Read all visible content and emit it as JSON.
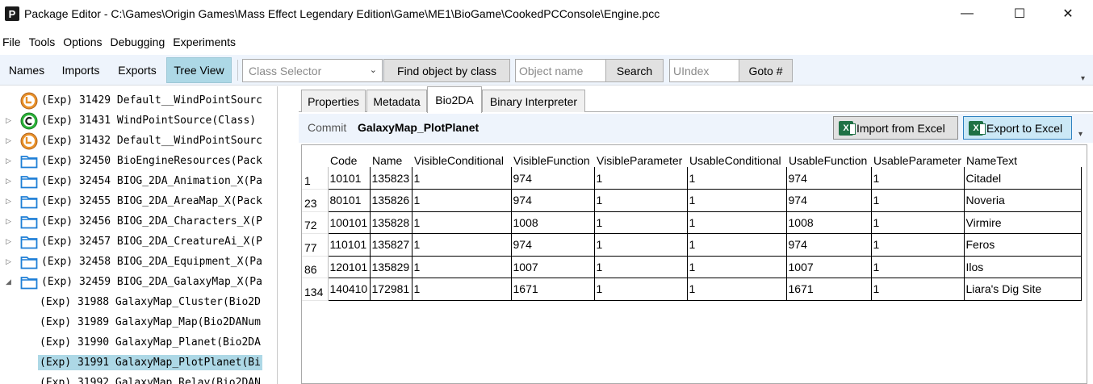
{
  "window": {
    "title": "Package Editor - C:\\Games\\Origin Games\\Mass Effect Legendary Edition\\Game\\ME1\\BioGame\\CookedPCConsole\\Engine.pcc",
    "logo_letter": "P",
    "minimize": "—",
    "maximize": "☐",
    "close": "✕"
  },
  "menu": [
    "File",
    "Tools",
    "Options",
    "Debugging",
    "Experiments"
  ],
  "toolbar": {
    "tabs": [
      "Names",
      "Imports",
      "Exports",
      "Tree View"
    ],
    "active_tab": "Tree View",
    "class_selector_placeholder": "Class Selector",
    "find_by_class_label": "Find object by class",
    "object_name_placeholder": "Object name",
    "search_label": "Search",
    "uindex_placeholder": "UIndex",
    "goto_label": "Goto #"
  },
  "tree": {
    "items": [
      {
        "expander": "",
        "icon": "orange-function-icon",
        "text": "(Exp) 31429 Default__WindPointSourc"
      },
      {
        "expander": "▷",
        "icon": "green-class-icon",
        "text": "(Exp) 31431 WindPointSource(Class)"
      },
      {
        "expander": "▷",
        "icon": "orange-function-icon",
        "text": "(Exp) 31432 Default__WindPointSourc"
      },
      {
        "expander": "▷",
        "icon": "folder-icon",
        "text": "(Exp) 32450 BioEngineResources(Pack"
      },
      {
        "expander": "▷",
        "icon": "folder-icon",
        "text": "(Exp) 32454 BIOG_2DA_Animation_X(Pa"
      },
      {
        "expander": "▷",
        "icon": "folder-icon",
        "text": "(Exp) 32455 BIOG_2DA_AreaMap_X(Pack"
      },
      {
        "expander": "▷",
        "icon": "folder-icon",
        "text": "(Exp) 32456 BIOG_2DA_Characters_X(P"
      },
      {
        "expander": "▷",
        "icon": "folder-icon",
        "text": "(Exp) 32457 BIOG_2DA_CreatureAi_X(P"
      },
      {
        "expander": "▷",
        "icon": "folder-icon",
        "text": "(Exp) 32458 BIOG_2DA_Equipment_X(Pa"
      },
      {
        "expander": "◢",
        "icon": "folder-icon",
        "text": "(Exp) 32459 BIOG_2DA_GalaxyMap_X(Pa"
      },
      {
        "expander": "",
        "icon": "",
        "text": "(Exp) 31988 GalaxyMap_Cluster(Bio2D"
      },
      {
        "expander": "",
        "icon": "",
        "text": "(Exp) 31989 GalaxyMap_Map(Bio2DANum"
      },
      {
        "expander": "",
        "icon": "",
        "text": "(Exp) 31990 GalaxyMap_Planet(Bio2DA"
      },
      {
        "expander": "",
        "icon": "",
        "text": "(Exp) 31991 GalaxyMap_PlotPlanet(Bi",
        "selected": true
      },
      {
        "expander": "",
        "icon": "",
        "text": "(Exp) 31992 GalaxyMap_Relay(Bio2DAN"
      }
    ]
  },
  "panel_tabs": [
    "Properties",
    "Metadata",
    "Bio2DA",
    "Binary Interpreter"
  ],
  "active_panel_tab": "Bio2DA",
  "commit": {
    "label": "Commit",
    "name": "GalaxyMap_PlotPlanet",
    "import_label": "Import from Excel",
    "export_label": "Export to Excel"
  },
  "grid": {
    "columns": [
      "Code",
      "Name",
      "VisibleConditional",
      "VisibleFunction",
      "VisibleParameter",
      "UsableConditional",
      "UsableFunction",
      "UsableParameter",
      "NameText"
    ],
    "rows": [
      {
        "header": "1",
        "cells": [
          "10101",
          "135823",
          "1",
          "974",
          "1",
          "1",
          "974",
          "1",
          "Citadel"
        ]
      },
      {
        "header": "23",
        "cells": [
          "80101",
          "135826",
          "1",
          "974",
          "1",
          "1",
          "974",
          "1",
          "Noveria"
        ]
      },
      {
        "header": "72",
        "cells": [
          "100101",
          "135828",
          "1",
          "1008",
          "1",
          "1",
          "1008",
          "1",
          "Virmire"
        ]
      },
      {
        "header": "77",
        "cells": [
          "110101",
          "135827",
          "1",
          "974",
          "1",
          "1",
          "974",
          "1",
          "Feros"
        ]
      },
      {
        "header": "86",
        "cells": [
          "120101",
          "135829",
          "1",
          "1007",
          "1",
          "1",
          "1007",
          "1",
          "Ilos"
        ]
      },
      {
        "header": "134",
        "cells": [
          "140410",
          "172981",
          "1",
          "1671",
          "1",
          "1",
          "1671",
          "1",
          "Liara's Dig Site"
        ]
      }
    ]
  },
  "colors": {
    "toolbar_bg": "#eef4fc",
    "selected": "#add8e6",
    "excel_green": "#1f7145"
  }
}
